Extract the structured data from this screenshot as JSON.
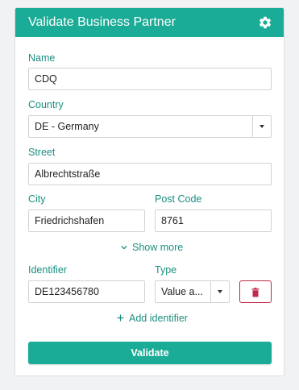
{
  "header": {
    "title": "Validate Business Partner",
    "settings_icon": "gear-icon"
  },
  "form": {
    "name": {
      "label": "Name",
      "value": "CDQ"
    },
    "country": {
      "label": "Country",
      "value": "DE - Germany"
    },
    "street": {
      "label": "Street",
      "value": "Albrechtstraße"
    },
    "city": {
      "label": "City",
      "value": "Friedrichshafen"
    },
    "post_code": {
      "label": "Post Code",
      "value": "8761"
    },
    "show_more": "Show more",
    "identifier": {
      "label": "Identifier",
      "value": "DE123456780"
    },
    "type": {
      "label": "Type",
      "value": "Value a..."
    },
    "add_identifier": "Add identifier",
    "validate": "Validate"
  },
  "colors": {
    "accent": "#1aac96",
    "label": "#1a8f80",
    "danger": "#c0294a"
  }
}
